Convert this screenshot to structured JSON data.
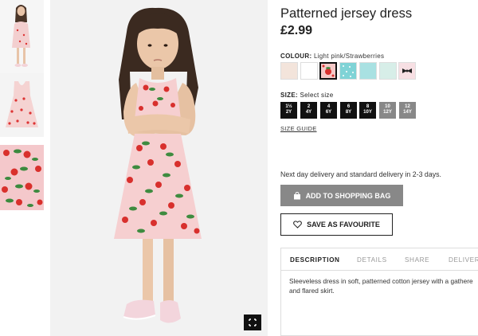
{
  "product": {
    "title": "Patterned jersey dress",
    "price": "£2.99"
  },
  "colour": {
    "label": "COLOUR:",
    "selected": "Light pink/Strawberries",
    "swatches": [
      {
        "name": "light-beige",
        "color": "#f3e4db"
      },
      {
        "name": "white",
        "color": "#ffffff"
      },
      {
        "name": "light-pink-strawberries",
        "color": "#f6c9c8",
        "selected": true
      },
      {
        "name": "turquoise-pattern",
        "color": "#7fd3d6"
      },
      {
        "name": "light-turquoise",
        "color": "#a9e1e2"
      },
      {
        "name": "mint",
        "color": "#d7eee8"
      },
      {
        "name": "pink-bow",
        "color": "#f7dfe3"
      }
    ]
  },
  "size": {
    "label": "SIZE:",
    "prompt": "Select size",
    "options": [
      {
        "label": "1½\n2Y",
        "available": true
      },
      {
        "label": "2\n4Y",
        "available": true
      },
      {
        "label": "4\n6Y",
        "available": true
      },
      {
        "label": "6\n8Y",
        "available": true
      },
      {
        "label": "8\n10Y",
        "available": true
      },
      {
        "label": "10\n12Y",
        "available": false
      },
      {
        "label": "12\n14Y",
        "available": false
      }
    ],
    "guide": "SIZE GUIDE"
  },
  "delivery_text": "Next day delivery and standard delivery in 2-3 days.",
  "buttons": {
    "add_to_bag": "ADD TO SHOPPING BAG",
    "save_favourite": "SAVE AS FAVOURITE"
  },
  "tabs": [
    {
      "label": "DESCRIPTION",
      "active": true
    },
    {
      "label": "DETAILS",
      "active": false
    },
    {
      "label": "SHARE",
      "active": false
    },
    {
      "label": "DELIVER",
      "active": false
    }
  ],
  "description": {
    "line1": "Sleeveless dress in soft, patterned cotton jersey with a gathere",
    "line2": "and flared skirt."
  },
  "icons": {
    "expand": "expand-icon",
    "bag": "shopping-bag-icon",
    "favourite": "heart-icon"
  },
  "colors": {
    "primary_dark": "#111111",
    "button_grey": "#888888",
    "dress_pink": "#f6cfd0",
    "strawberry_red": "#d8302d"
  }
}
